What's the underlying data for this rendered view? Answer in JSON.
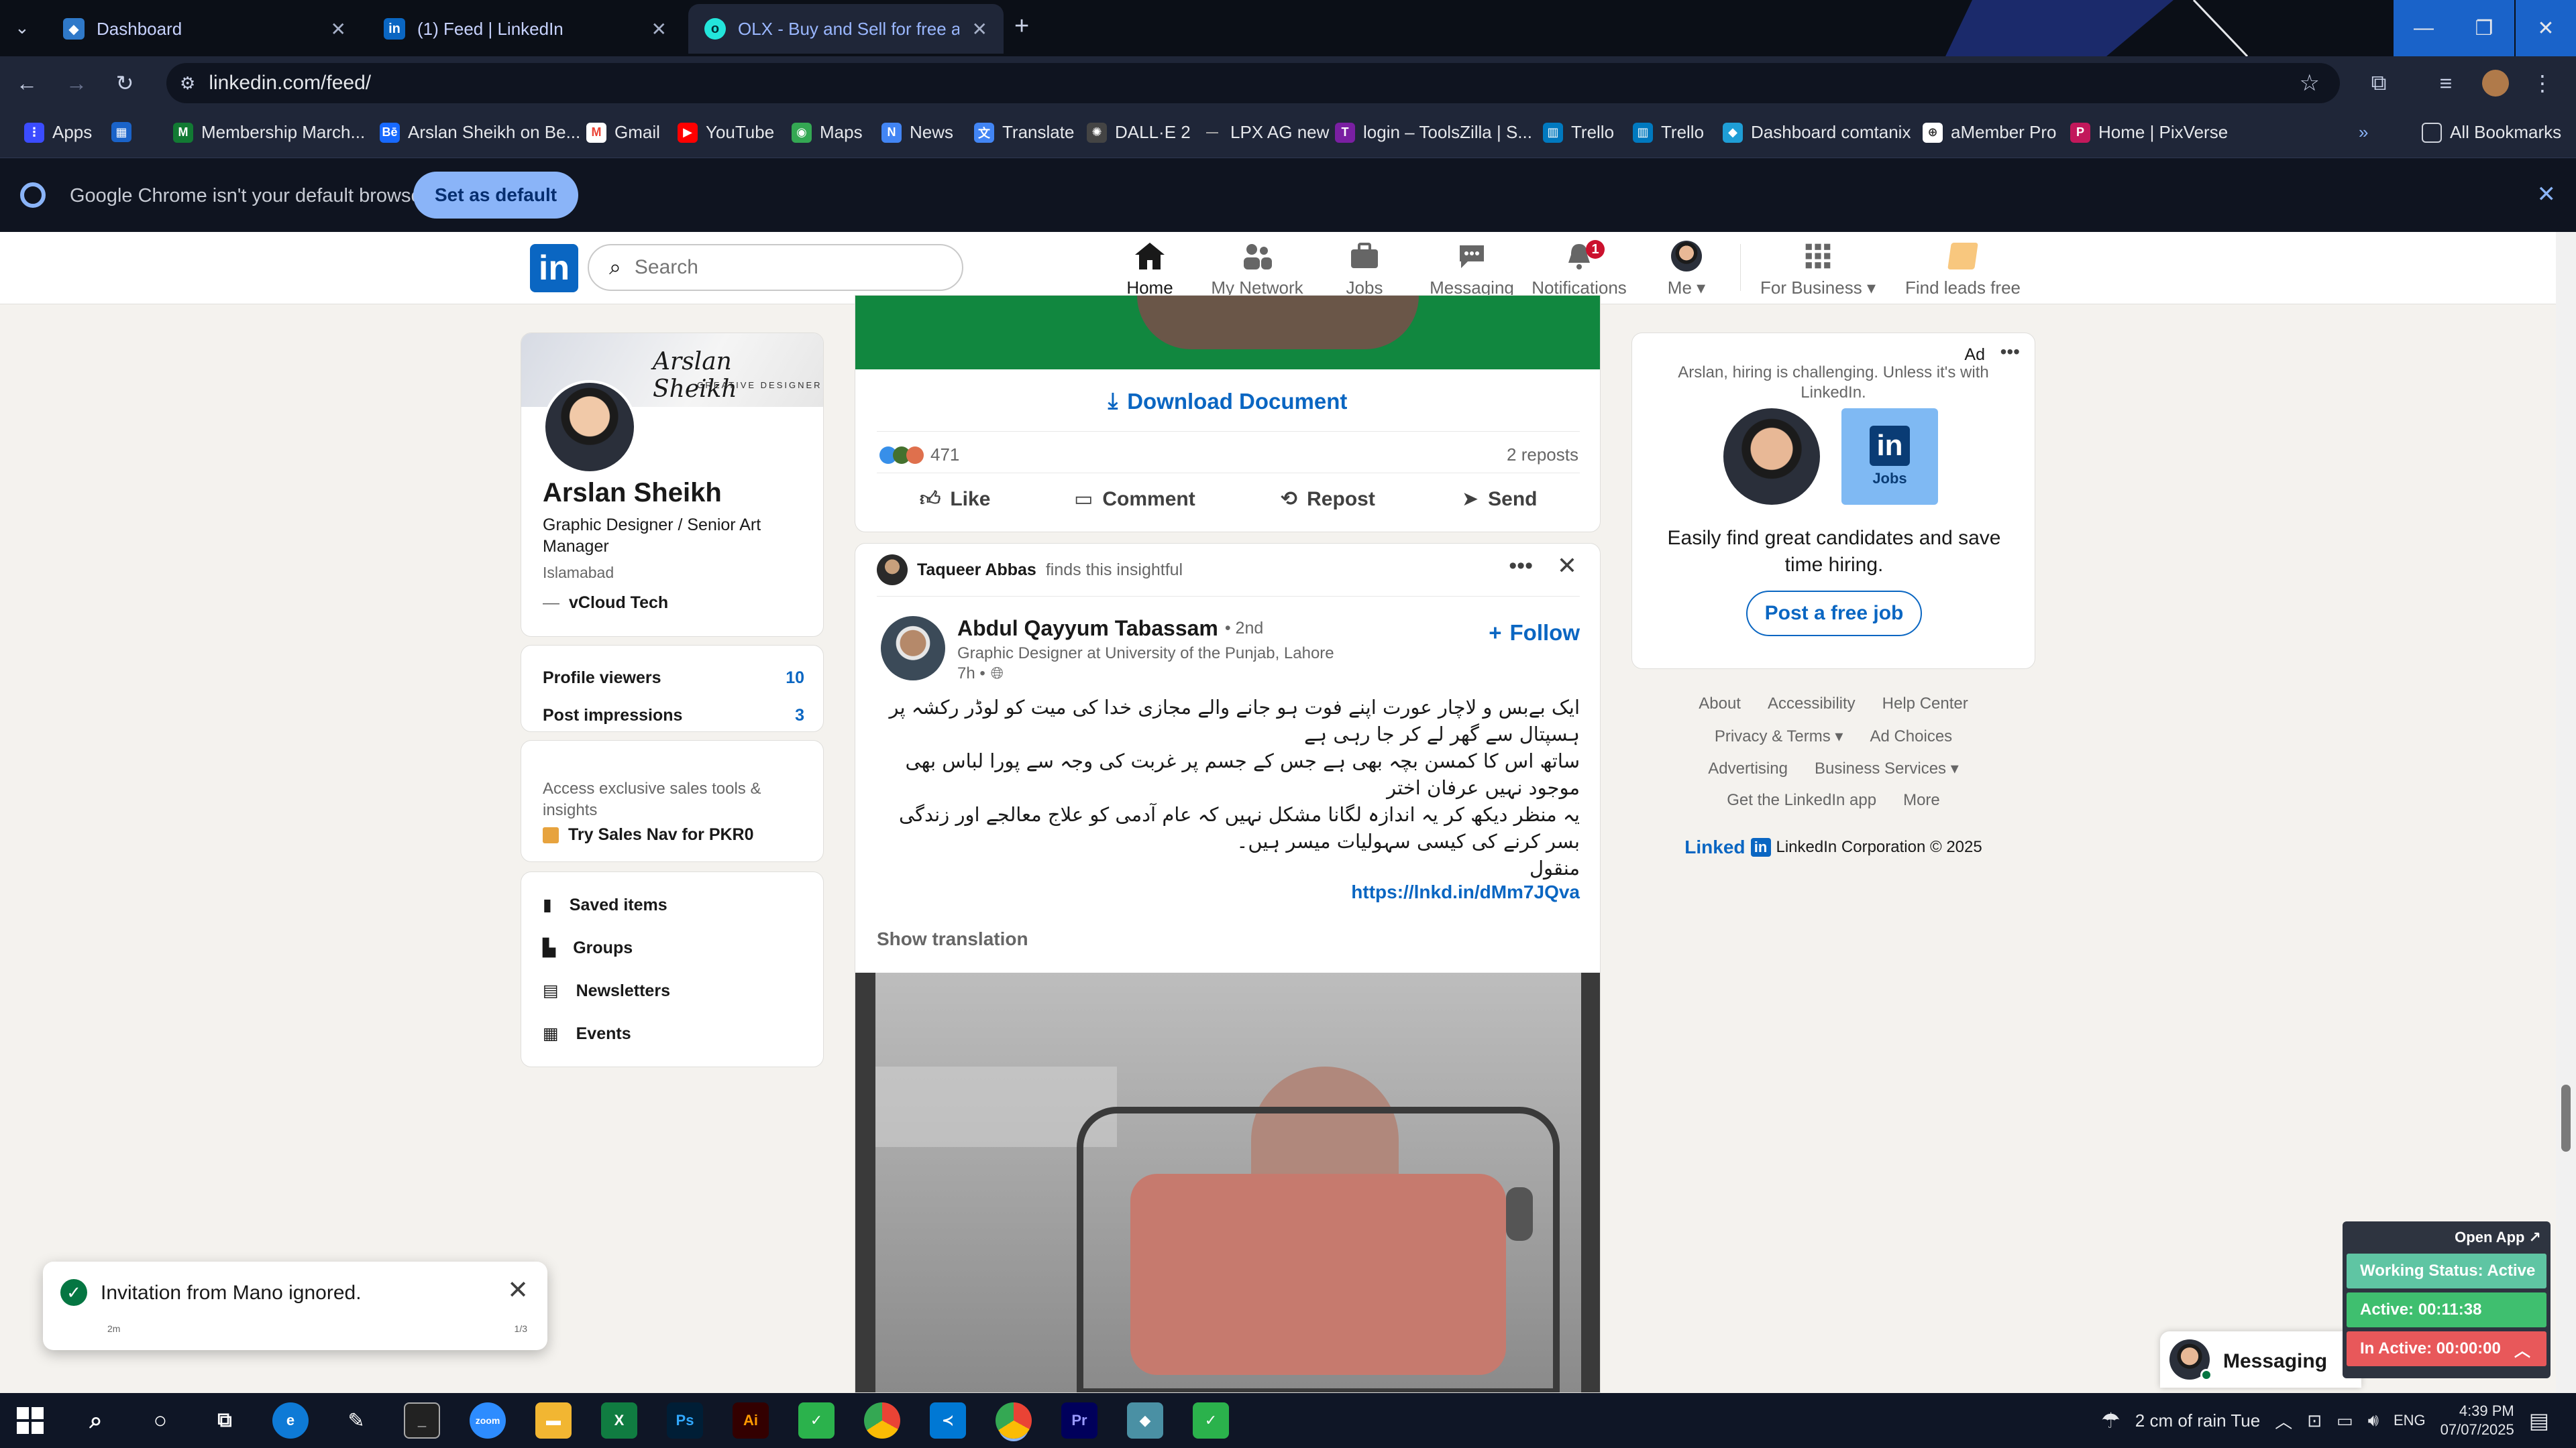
{
  "browser": {
    "tabs": [
      {
        "title": "Dashboard",
        "active": false
      },
      {
        "title": "(1) Feed | LinkedIn",
        "active": false
      },
      {
        "title": "OLX - Buy and Sell for free any",
        "active": true
      }
    ],
    "url": "linkedin.com/feed/",
    "bookmarks": [
      "Apps",
      "Membership March...",
      "Arslan Sheikh on Be...",
      "Gmail",
      "YouTube",
      "Maps",
      "News",
      "Translate",
      "DALL·E 2",
      "LPX AG new",
      "login – ToolsZilla | S...",
      "Trello",
      "Trello",
      "Dashboard comtanix",
      "aMember Pro",
      "Home | PixVerse"
    ],
    "all_bookmarks": "All Bookmarks",
    "default_prompt": "Google Chrome isn't your default browser",
    "set_default_label": "Set as default"
  },
  "linkedin": {
    "logo": "in",
    "search_placeholder": "Search",
    "nav": [
      {
        "label": "Home",
        "icon": "home-icon"
      },
      {
        "label": "My Network",
        "icon": "network-icon"
      },
      {
        "label": "Jobs",
        "icon": "briefcase-icon"
      },
      {
        "label": "Messaging",
        "icon": "messaging-icon"
      },
      {
        "label": "Notifications",
        "icon": "bell-icon",
        "badge": "1"
      },
      {
        "label": "Me",
        "icon": "avatar"
      },
      {
        "label": "For Business",
        "icon": "grid-icon"
      },
      {
        "label": "Find leads free",
        "icon": "leads-icon"
      }
    ]
  },
  "profile": {
    "cover_text": "Arslan Sheikh",
    "cover_subtext": "CREATIVE DESIGNER",
    "name": "Arslan Sheikh",
    "headline": "Graphic Designer / Senior Art Manager",
    "location": "Islamabad",
    "company": "vCloud Tech",
    "stats": [
      {
        "label": "Profile viewers",
        "value": "10"
      },
      {
        "label": "Post impressions",
        "value": "3"
      }
    ],
    "premium_text": "Access exclusive sales tools & insights",
    "premium_cta": "Try Sales Nav for PKR0",
    "links": [
      "Saved items",
      "Groups",
      "Newsletters",
      "Events"
    ]
  },
  "post1": {
    "download_label": "Download Document",
    "reaction_count": "471",
    "reposts": "2 reposts",
    "actions": [
      "Like",
      "Comment",
      "Repost",
      "Send"
    ]
  },
  "post2": {
    "context_name": "Taqueer Abbas",
    "context_text": "finds this insightful",
    "author": "Abdul Qayyum Tabassam",
    "degree": "• 2nd",
    "author_headline": "Graphic Designer at University of the Punjab, Lahore",
    "time": "7h •",
    "follow_label": "Follow",
    "body_lines": [
      "ایک بےبس و لاچار عورت اپنے فوت ہو جانے والے مجازی خدا کی میت کو لوڈر رکشہ پر ہسپتال سے گھر لے کر جا رہی ہے",
      "ساتھ اس کا کمسن بچہ بھی ہے جس کے جسم پر غربت کی وجہ سے پورا لباس بھی موجود نہیں عرفان اختر",
      "یہ منظر دیکھ کر یہ اندازہ لگانا مشکل نہیں کہ عام آدمی کو علاج معالجے اور زندگی بسر کرنے کی کیسی سہولیات میسر ہیں۔",
      "منقول"
    ],
    "link": "https://lnkd.in/dMm7JQva",
    "show_translation": "Show translation"
  },
  "ad": {
    "label": "Ad",
    "tagline": "Arslan, hiring is challenging. Unless it's with LinkedIn.",
    "jobs_badge": "Jobs",
    "headline": "Easily find great candidates and save time hiring.",
    "cta": "Post a free job"
  },
  "footer": {
    "links": [
      "About",
      "Accessibility",
      "Help Center",
      "Privacy & Terms",
      "Ad Choices",
      "Advertising",
      "Business Services",
      "Get the LinkedIn app",
      "More"
    ],
    "brand": "Linked",
    "copyright": "LinkedIn Corporation © 2025"
  },
  "toast": {
    "message": "Invitation from Mano ignored.",
    "left_meta": "2m",
    "right_meta": "1/3"
  },
  "messaging_label": "Messaging",
  "tracker": {
    "open_app": "Open App ↗",
    "working": "Working Status: Active",
    "active": "Active: 00:11:38",
    "inactive": "In Active: 00:00:00"
  },
  "taskbar": {
    "weather": "2 cm of rain Tue",
    "lang": "ENG",
    "time": "4:39 PM",
    "date": "07/07/2025"
  },
  "colors": {
    "linkedin_blue": "#0a66c2",
    "feed_green": "#11873f",
    "working_status": "#5fc5a3",
    "active": "#3fbf6f",
    "inactive": "#e8585a"
  }
}
